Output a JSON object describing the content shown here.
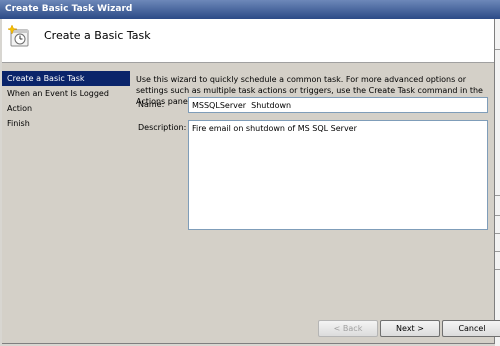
{
  "window": {
    "title": "Create Basic Task Wizard"
  },
  "header": {
    "title": "Create a Basic Task",
    "icon": "scheduled-task-clock-icon"
  },
  "nav": {
    "items": [
      {
        "label": "Create a Basic Task",
        "active": true
      },
      {
        "label": "When an Event Is Logged",
        "active": false
      },
      {
        "label": "Action",
        "active": false
      },
      {
        "label": "Finish",
        "active": false
      }
    ]
  },
  "main": {
    "intro": "Use this wizard to quickly schedule a common task.  For more advanced options or settings such as multiple task actions or triggers, use the Create Task command in the Actions pane.",
    "name_label": "Name:",
    "name_value": "MSSQLServer  Shutdown",
    "description_label": "Description:",
    "description_value": "Fire email on shutdown of MS SQL Server"
  },
  "buttons": {
    "back": "< Back",
    "next": "Next >",
    "cancel": "Cancel"
  },
  "colors": {
    "title_bar": "#2b4a86",
    "nav_selected": "#0a246a",
    "dialog_bg": "#d4d0c8"
  }
}
